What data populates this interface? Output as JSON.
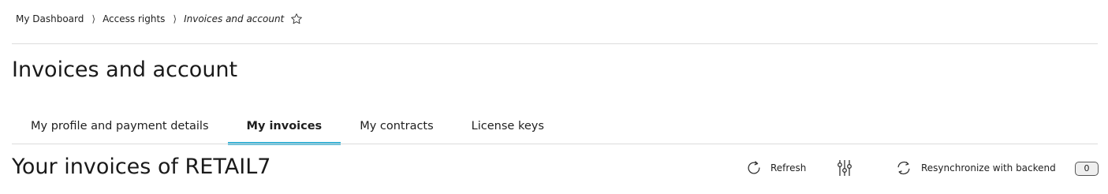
{
  "breadcrumb": {
    "items": [
      "My Dashboard",
      "Access rights"
    ],
    "current": "Invoices and account",
    "separator": "⟩"
  },
  "page": {
    "title": "Invoices and account"
  },
  "tabs": [
    {
      "label": "My profile and payment details",
      "active": false
    },
    {
      "label": "My invoices",
      "active": true
    },
    {
      "label": "My contracts",
      "active": false
    },
    {
      "label": "License keys",
      "active": false
    }
  ],
  "section": {
    "title": "Your invoices of RETAIL7"
  },
  "toolbar": {
    "refresh_label": "Refresh",
    "resync_label": "Resynchronize with backend",
    "count": "0"
  },
  "colors": {
    "accent": "#3bb3d6",
    "divider": "#dcdcdc",
    "text": "#1f1f1f"
  },
  "icons": [
    "star-icon",
    "refresh-icon",
    "filter-sliders-icon",
    "sync-icon"
  ]
}
